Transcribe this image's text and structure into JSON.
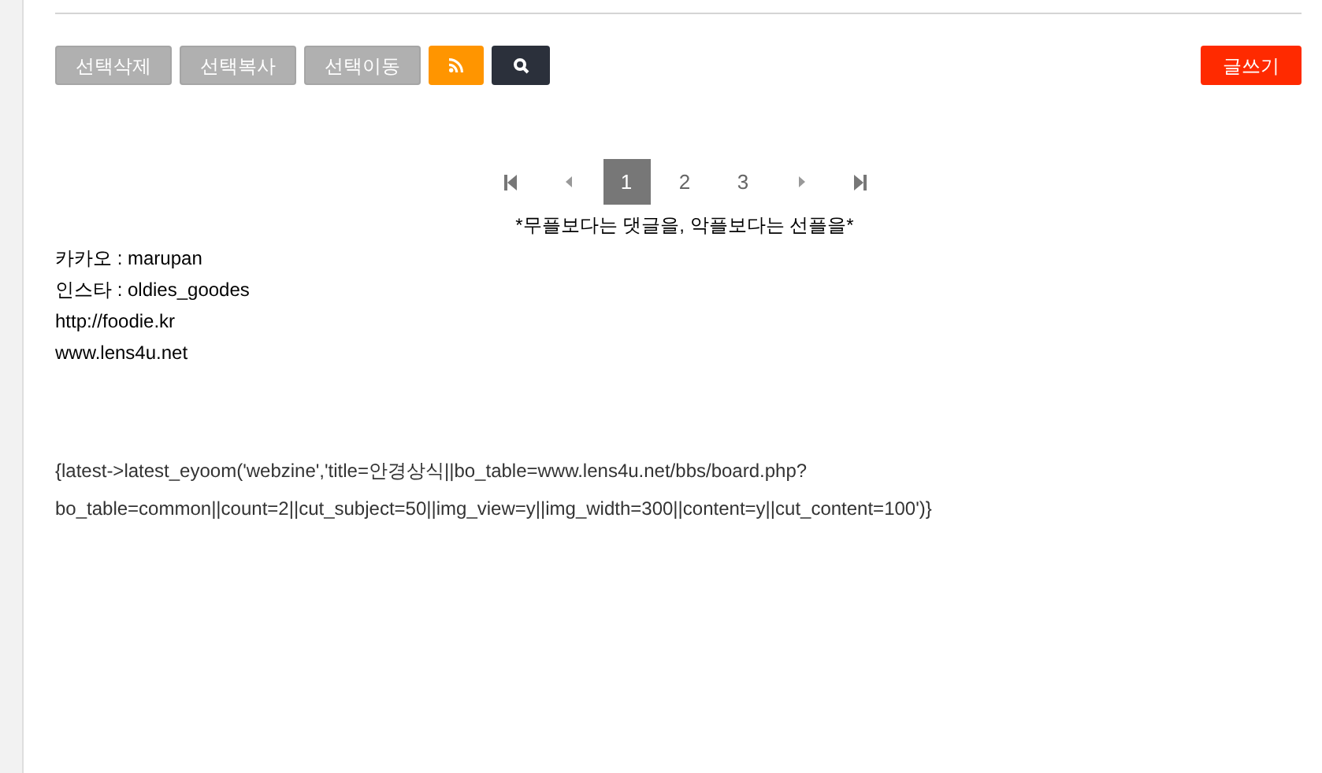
{
  "toolbar": {
    "buttons": [
      {
        "label": "선택삭제",
        "kind": "text"
      },
      {
        "label": "선택복사",
        "kind": "text"
      },
      {
        "label": "선택이동",
        "kind": "text"
      },
      {
        "kind": "rss"
      },
      {
        "kind": "search"
      }
    ],
    "write_button": "글쓰기"
  },
  "pagination": {
    "pages": [
      {
        "label": "1",
        "selected": true
      },
      {
        "label": "2",
        "selected": false
      },
      {
        "label": "3",
        "selected": false
      }
    ]
  },
  "motto": "*무플보다는 댓글을, 악플보다는 선플을*",
  "contacts": [
    "카카오 : marupan",
    "인스타 : oldies_goodes",
    "http://foodie.kr",
    "www.lens4u.net"
  ],
  "code_lines": [
    "{latest->latest_eyoom('webzine','title=안경상식||bo_table=www.lens4u.net/bbs/board.php?",
    "bo_table=common||count=2||cut_subject=50||img_view=y||img_width=300||content=y||cut_content=100')}"
  ]
}
